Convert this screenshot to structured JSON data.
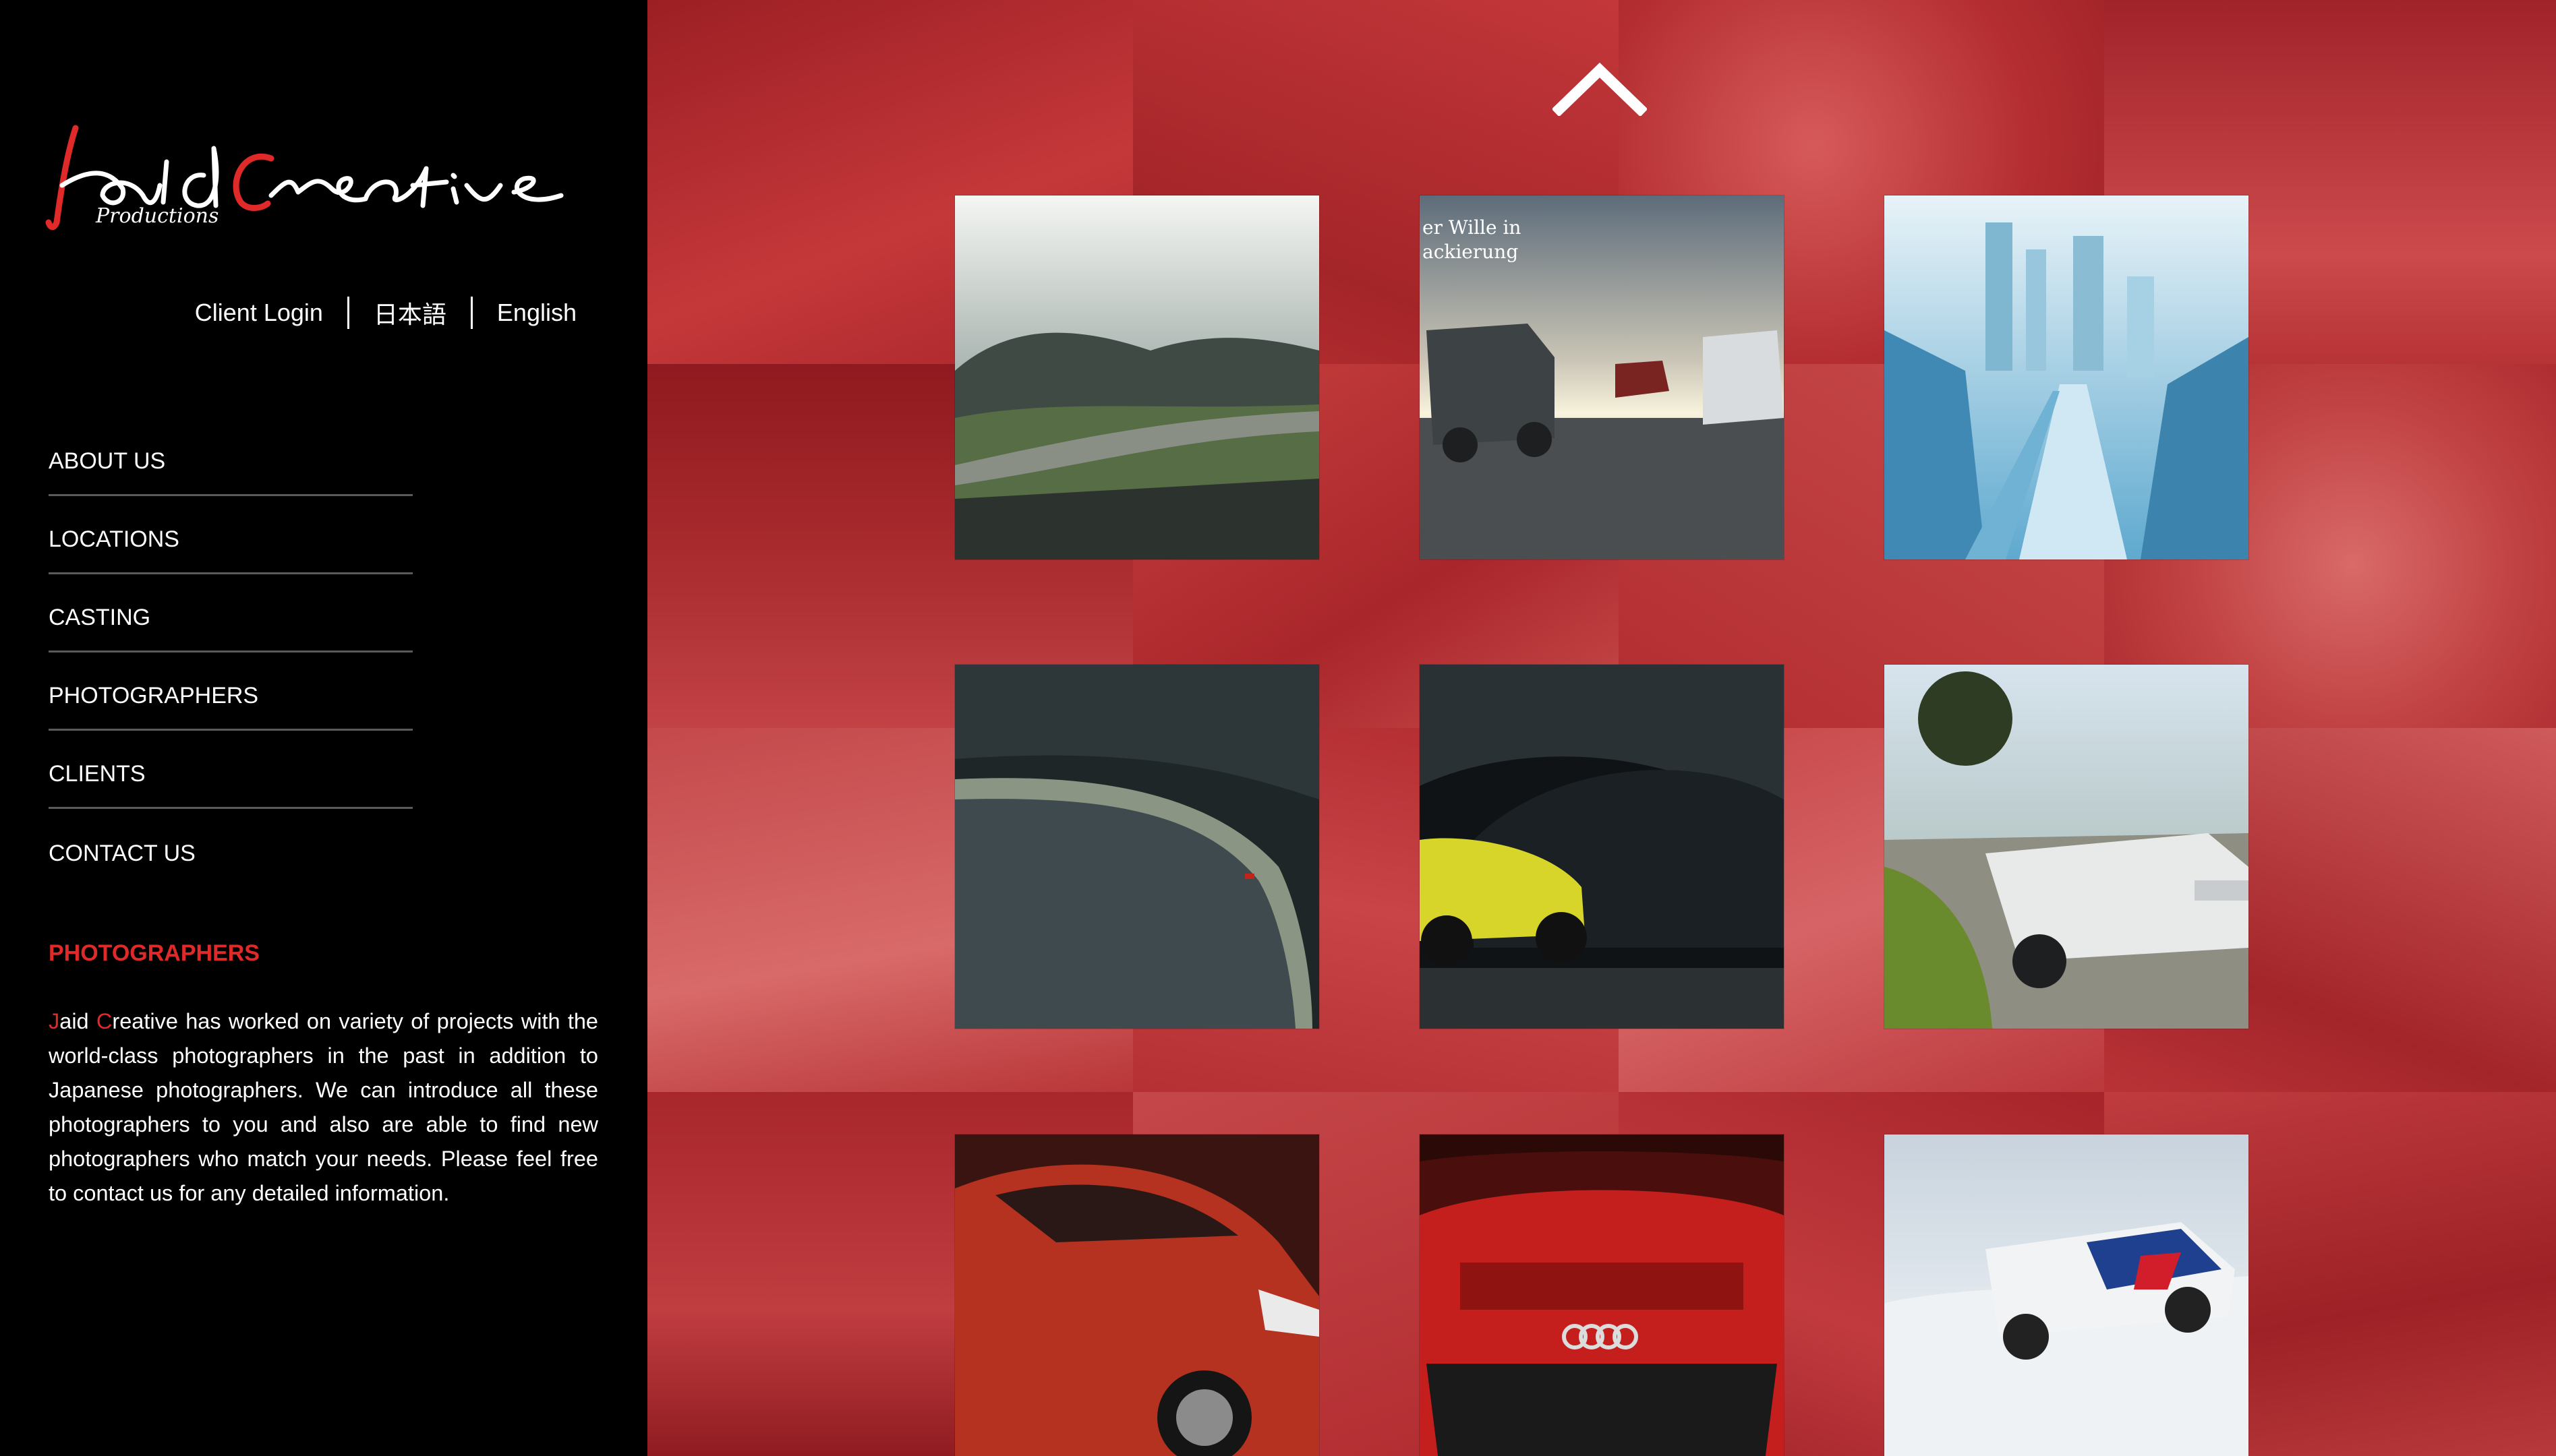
{
  "brand": {
    "name": "JaidCreative",
    "subtitle": "Productions",
    "accent_color": "#e02a2a"
  },
  "lang_bar": {
    "client_login": "Client Login",
    "japanese": "日本語",
    "english": "English"
  },
  "nav": {
    "items": [
      {
        "label": "ABOUT US"
      },
      {
        "label": "LOCATIONS"
      },
      {
        "label": "CASTING"
      },
      {
        "label": "PHOTOGRAPHERS"
      },
      {
        "label": "CLIENTS"
      },
      {
        "label": "CONTACT US"
      }
    ]
  },
  "section": {
    "title": "PHOTOGRAPHERS",
    "description_initial_1": "J",
    "description_part_1": "aid ",
    "description_initial_2": "C",
    "description_part_2": "reative has worked on variety of projects with the world-class photographers in the past in addition to Japanese photographers. We can introduce all these photographers to you and also are able to find new photographers who match your needs. Please feel free to contact us for any detailed information."
  },
  "gallery": {
    "scroll_up_icon": "chevron-up-icon",
    "thumbnails": [
      {
        "subject": "mountain road landscape"
      },
      {
        "subject": "mercedes vans at sunset",
        "caption_line_1": "er Wille in",
        "caption_line_2": "ackierung"
      },
      {
        "subject": "abstract blue city"
      },
      {
        "subject": "dam with road"
      },
      {
        "subject": "yellow beetle in tunnel"
      },
      {
        "subject": "white convertible on road"
      },
      {
        "subject": "red hatchback e-tron"
      },
      {
        "subject": "red audi e-tron front"
      },
      {
        "subject": "rally car on snow"
      }
    ]
  }
}
